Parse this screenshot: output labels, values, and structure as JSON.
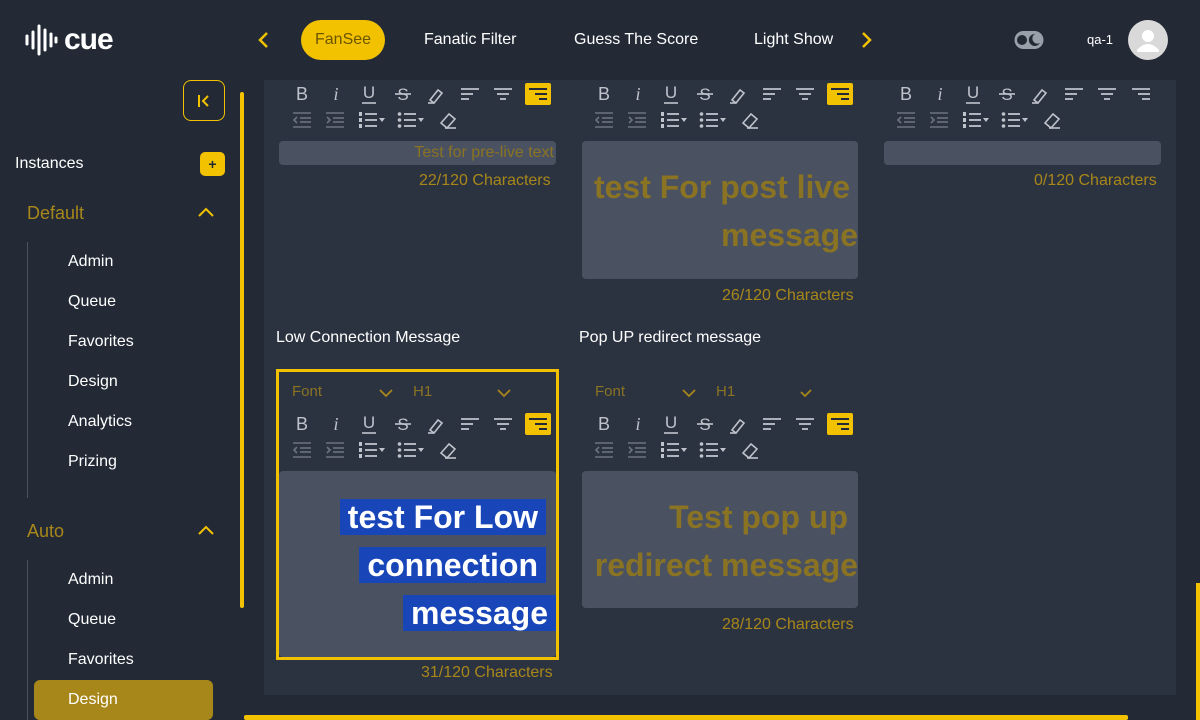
{
  "header": {
    "logo_text": "cue",
    "tabs": [
      {
        "label": "FanSee",
        "active": true
      },
      {
        "label": "Fanatic Filter"
      },
      {
        "label": "Guess The Score"
      },
      {
        "label": "Light Show"
      }
    ],
    "user_name": "qa-1"
  },
  "sidebar": {
    "instances_label": "Instances",
    "add_label": "+",
    "groups": [
      {
        "title": "Default",
        "items": [
          "Admin",
          "Queue",
          "Favorites",
          "Design",
          "Analytics",
          "Prizing"
        ]
      },
      {
        "title": "Auto",
        "items": [
          "Admin",
          "Queue",
          "Favorites",
          "Design"
        ],
        "active_item": "Design"
      }
    ]
  },
  "editors": {
    "pre_live": {
      "text": "Test for pre-live text",
      "count": "22/120 Characters"
    },
    "post_live": {
      "text_line1": "test For post live",
      "text_line2": "message",
      "count": "26/120 Characters"
    },
    "third": {
      "text": "",
      "count": "0/120 Characters"
    },
    "low_connection": {
      "label": "Low Connection Message",
      "font_placeholder": "Font",
      "heading": "H1",
      "text_line1": "test For Low",
      "text_line2": "connection",
      "text_line3": "message",
      "count": "31/120 Characters"
    },
    "popup": {
      "label": "Pop UP redirect message",
      "font_placeholder": "Font",
      "heading": "H1",
      "text_line1": "Test pop up",
      "text_line2": "redirect message",
      "count": "28/120 Characters"
    }
  },
  "colors": {
    "accent": "#f2c200",
    "accent_dark": "#a8871a",
    "bg": "#232a36",
    "panel": "#2c3340",
    "editor": "#4a5262",
    "selection": "#1845b8"
  }
}
